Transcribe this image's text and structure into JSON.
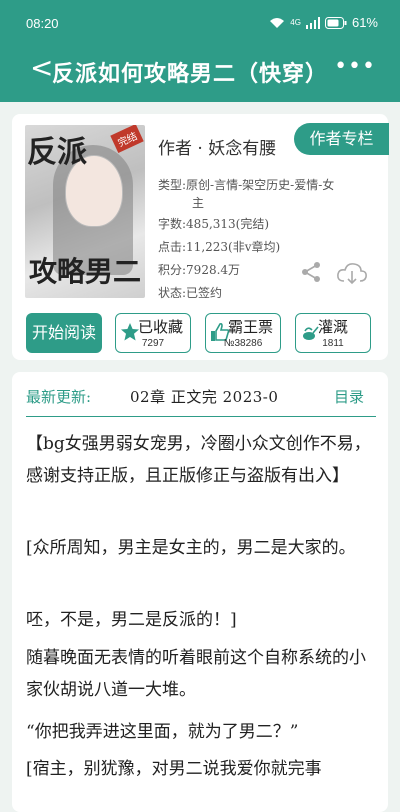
{
  "status": {
    "time": "08:20",
    "battery": "61%",
    "network": "4G"
  },
  "nav": {
    "title": "反派如何攻略男二（快穿）",
    "back_icon": "chevron-left-icon",
    "more_icon": "more-dots-icon"
  },
  "book": {
    "cover_title_top": "反派",
    "cover_title_bottom": "攻略男二",
    "cover_tag": "完结",
    "author": "作者 · 妖念有腰",
    "author_button": "作者专栏",
    "meta": [
      {
        "label": "类型:",
        "value": "原创-言情-架空历史-爱情-女"
      },
      {
        "label": "",
        "value": "主"
      },
      {
        "label": "字数:",
        "value": "485,313(完结)"
      },
      {
        "label": "点击:",
        "value": "11,223(非v章均)"
      },
      {
        "label": "积分:",
        "value": "7928.4万"
      },
      {
        "label": "状态:",
        "value": "已签约"
      }
    ]
  },
  "actions": {
    "read": "开始阅读",
    "collect": {
      "label": "已收藏",
      "count": "7297"
    },
    "bawang": {
      "label": "霸王票",
      "count": "№38286"
    },
    "water": {
      "label": "灌溉",
      "count": "1811"
    }
  },
  "update": {
    "label": "最新更新:",
    "value": "02章  正文完  2023-0",
    "dir": "目录"
  },
  "content": [
    "【bg女强男弱女宠男，冷圈小众文创作不易，感谢支持正版，且正版修正与盗版有出入】",
    "[众所周知，男主是女主的，男二是大家的。",
    "呸，不是，男二是反派的！]",
    "随暮晚面无表情的听着眼前这个自称系统的小家伙胡说八道一大堆。",
    "“你把我弄进这里面，就为了男二？”",
    "[宿主，别犹豫，对男二说我爱你就完事"
  ],
  "colors": {
    "accent": "#2e9c88",
    "bg": "#eef3f1"
  }
}
